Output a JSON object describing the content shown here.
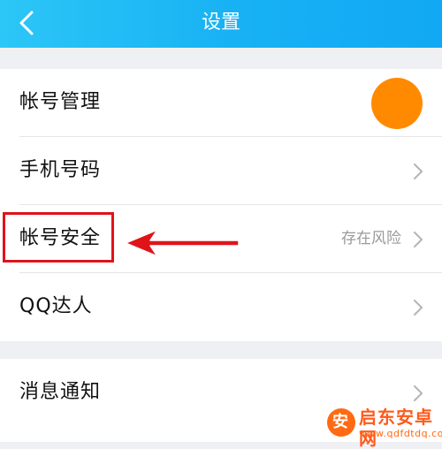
{
  "header": {
    "title": "设置",
    "color": "#17b1f4"
  },
  "groups": [
    {
      "rows": [
        {
          "label": "帐号管理",
          "status": "",
          "has_avatar": true,
          "has_chevron": false
        },
        {
          "label": "手机号码",
          "status": "",
          "has_avatar": false,
          "has_chevron": true
        },
        {
          "label": "帐号安全",
          "status": "存在风险",
          "has_avatar": false,
          "has_chevron": true
        },
        {
          "label": "QQ达人",
          "status": "",
          "has_avatar": false,
          "has_chevron": true
        }
      ]
    },
    {
      "rows": [
        {
          "label": "消息通知",
          "status": "",
          "has_avatar": false,
          "has_chevron": true
        }
      ]
    }
  ],
  "avatar": {
    "color": "#ff8a00"
  },
  "annotation": {
    "highlight_color": "#e0131a",
    "target": "帐号安全"
  },
  "watermark": {
    "icon_glyph": "安",
    "brand": "启东安卓网",
    "url": "www.qdfdtdq.com"
  }
}
